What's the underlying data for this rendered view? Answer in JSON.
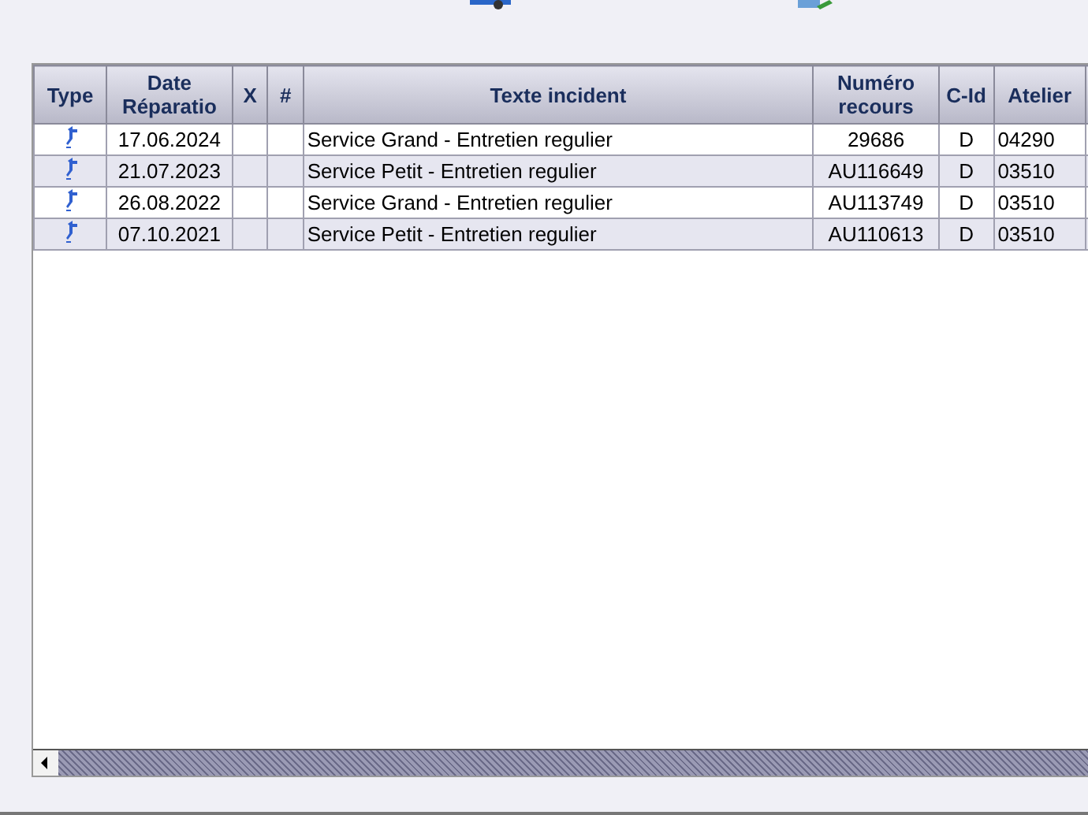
{
  "table": {
    "columns": [
      {
        "label": "Type"
      },
      {
        "label": "Date\nRéparatio"
      },
      {
        "label": "X"
      },
      {
        "label": "#"
      },
      {
        "label": "Texte incident"
      },
      {
        "label": "Numéro\nrecours"
      },
      {
        "label": "C-Id"
      },
      {
        "label": "Atelier"
      }
    ],
    "rows": [
      {
        "date": "17.06.2024",
        "text": "Service Grand - Entretien regulier",
        "recours": "29686",
        "cid": "D",
        "atelier": "04290"
      },
      {
        "date": "21.07.2023",
        "text": "Service Petit - Entretien regulier",
        "recours": "AU116649",
        "cid": "D",
        "atelier": "03510"
      },
      {
        "date": "26.08.2022",
        "text": "Service Grand - Entretien regulier",
        "recours": "AU113749",
        "cid": "D",
        "atelier": "03510"
      },
      {
        "date": "07.10.2021",
        "text": "Service Petit - Entretien regulier",
        "recours": "AU110613",
        "cid": "D",
        "atelier": "03510"
      }
    ]
  }
}
